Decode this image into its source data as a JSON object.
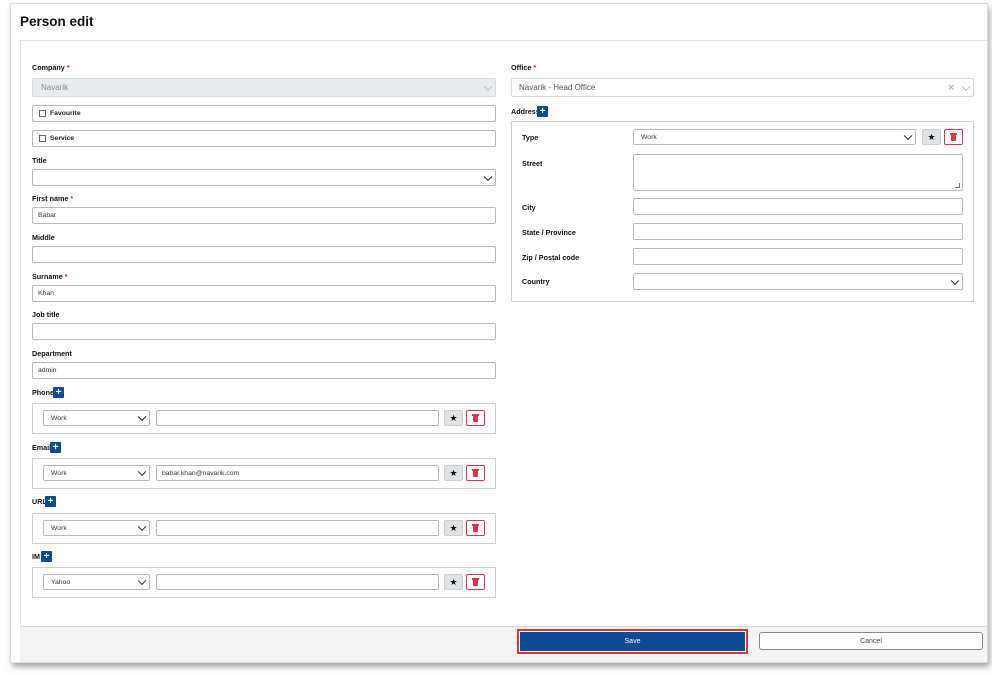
{
  "page": {
    "title": "Person edit"
  },
  "company": {
    "label": "Company",
    "value": "Navarik"
  },
  "office": {
    "label": "Office",
    "value": "Navarik - Head Office"
  },
  "checkboxes": {
    "favourite": "Favourite",
    "service": "Service"
  },
  "title_field": {
    "label": "Title",
    "value": ""
  },
  "first_name": {
    "label": "First name",
    "value": "Babar"
  },
  "middle": {
    "label": "Middle",
    "value": ""
  },
  "surname": {
    "label": "Surname",
    "value": "Khan"
  },
  "job_title": {
    "label": "Job title",
    "value": ""
  },
  "department": {
    "label": "Department",
    "value": "admin"
  },
  "required_mark": "*",
  "add_symbol": "+",
  "star_symbol": "★",
  "phone": {
    "label": "Phone",
    "type": "Work",
    "value": ""
  },
  "email": {
    "label": "Email",
    "type": "Work",
    "value": "babar.khan@navarik.com"
  },
  "url": {
    "label": "URL",
    "type": "Work",
    "value": ""
  },
  "im": {
    "label": "IM",
    "type": "Yahoo",
    "value": ""
  },
  "address": {
    "label": "Address",
    "type_label": "Type",
    "type_value": "Work",
    "street_label": "Street",
    "street_value": "",
    "city_label": "City",
    "city_value": "",
    "state_label": "State / Province",
    "state_value": "",
    "zip_label": "Zip / Postal code",
    "zip_value": "",
    "country_label": "Country",
    "country_value": ""
  },
  "footer": {
    "save": "Save",
    "cancel": "Cancel"
  },
  "colors": {
    "primary": "#0d4b92",
    "danger": "#dc3545",
    "required": "#d9243c",
    "highlight": "#e0343d"
  }
}
